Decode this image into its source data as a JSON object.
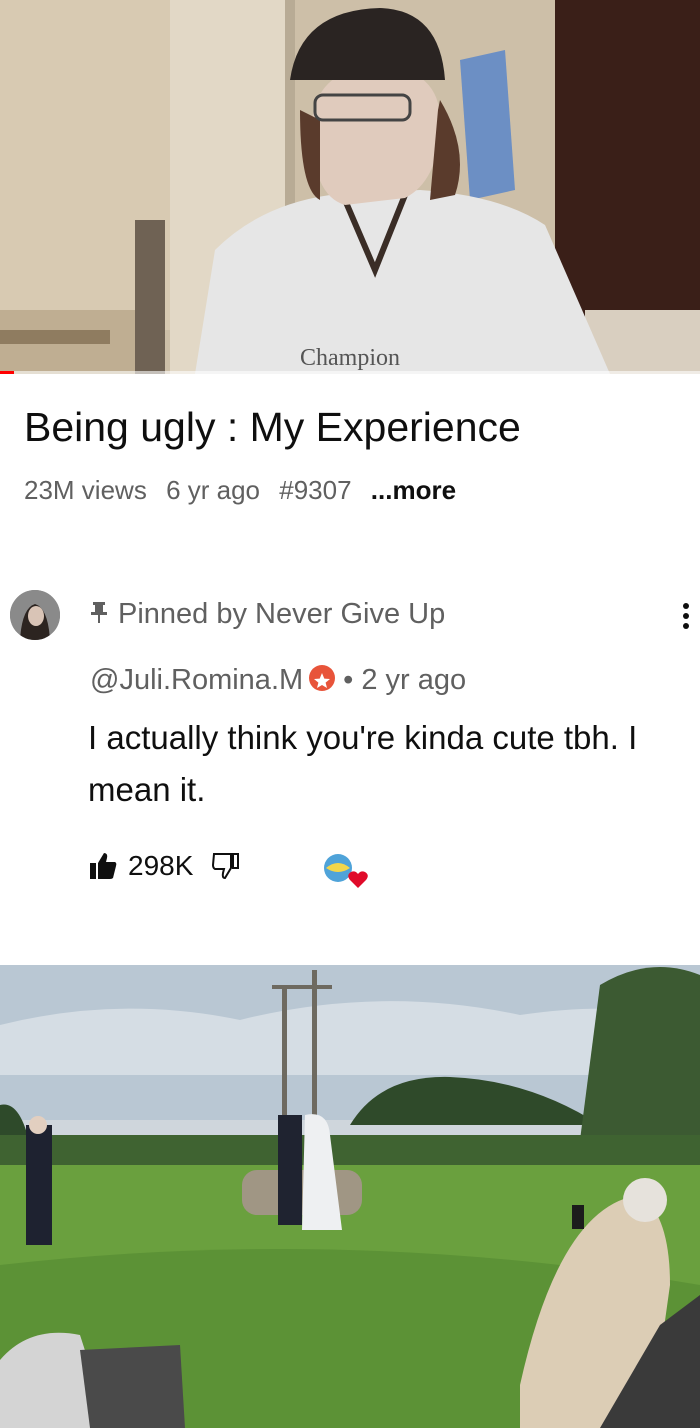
{
  "video": {
    "title": "Being ugly : My Experience",
    "views": "23M views",
    "age": "6 yr ago",
    "hashtag": "#9307",
    "more_label": "...more",
    "progress": 0.02
  },
  "comment": {
    "pinned_label": "Pinned by Never Give Up",
    "handle": "@Juli.Romina.M",
    "age": "• 2 yr ago",
    "text": "I actually think you're kinda cute tbh. I mean it.",
    "likes": "298K",
    "icons": [
      "pin-icon",
      "like-icon",
      "dislike-icon",
      "creator-heart-icon",
      "more-vert-icon",
      "member-badge-icon"
    ]
  },
  "colors": {
    "progress": "#ff0000",
    "heart": "#e00b2a",
    "badge": "#e8543a",
    "meta": "#606060"
  }
}
